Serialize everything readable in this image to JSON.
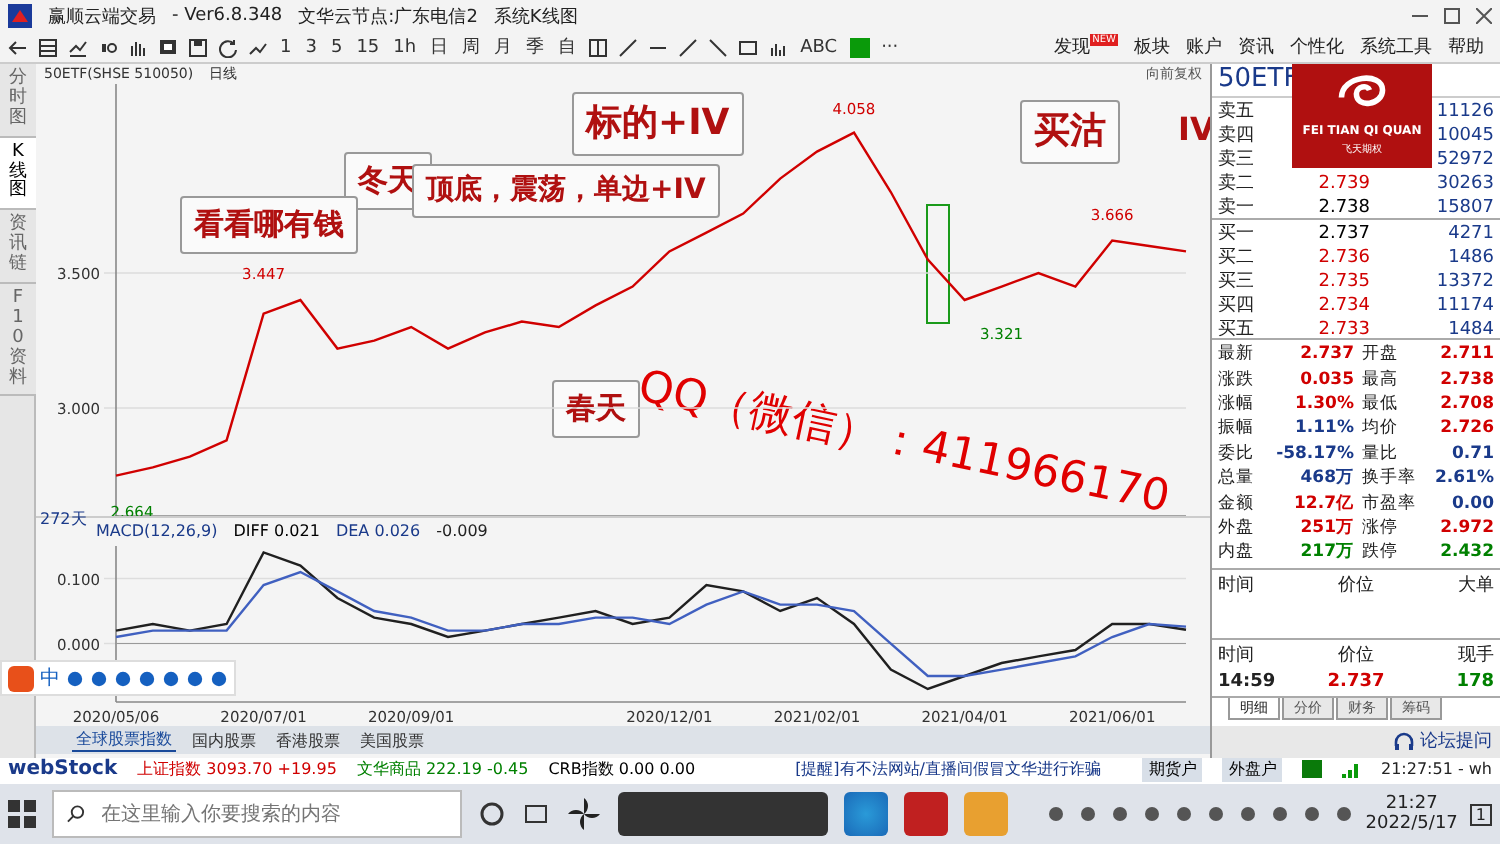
{
  "window": {
    "title": "赢顺云端交易",
    "version": "- Ver6.8.348",
    "node": "文华云节点:广东电信2",
    "view": "系统K线图"
  },
  "toolbar": {
    "periods": [
      "1",
      "3",
      "5",
      "15",
      "1h",
      "日",
      "周",
      "月",
      "季",
      "自"
    ],
    "text_tools": [
      "ABC",
      "···"
    ]
  },
  "menu": [
    {
      "label": "发现",
      "badge": "NEW"
    },
    {
      "label": "板块"
    },
    {
      "label": "账户"
    },
    {
      "label": "资讯"
    },
    {
      "label": "个性化"
    },
    {
      "label": "系统工具"
    },
    {
      "label": "帮助"
    }
  ],
  "side_tabs": [
    {
      "label": "分时图",
      "selected": false
    },
    {
      "label": "K线图",
      "selected": true
    },
    {
      "label": "资讯链",
      "selected": false
    },
    {
      "label": "F10资料",
      "selected": false
    }
  ],
  "chart": {
    "symbol": "50ETF(SHSE 510050)",
    "period": "日线",
    "adjust": "向前复权",
    "span_label": "272天",
    "chart_data": {
      "type": "line",
      "ylim": [
        2.6,
        4.2
      ],
      "yticks": [
        {
          "value": 3.0,
          "label": "3.000"
        },
        {
          "value": 3.5,
          "label": "3.500"
        }
      ],
      "series": [
        {
          "color": "#d00000",
          "values": [
            2.75,
            2.78,
            2.82,
            2.88,
            3.35,
            3.4,
            3.22,
            3.25,
            3.3,
            3.22,
            3.28,
            3.32,
            3.3,
            3.38,
            3.45,
            3.58,
            3.65,
            3.72,
            3.85,
            3.95,
            4.02,
            3.8,
            3.55,
            3.4,
            3.45,
            3.5,
            3.45,
            3.62,
            3.6,
            3.58
          ]
        }
      ],
      "annotations": [
        "2.664",
        "3.447",
        "4.058",
        "3.321",
        "3.666"
      ]
    }
  },
  "notes": [
    {
      "text": "标的+IV",
      "kind": "boxed"
    },
    {
      "text": "买沽",
      "kind": "boxed"
    },
    {
      "text": "IV",
      "kind": "plain"
    },
    {
      "text": "冬天",
      "kind": "boxed"
    },
    {
      "text": "看看哪有钱",
      "kind": "boxed"
    },
    {
      "text": "顶底，震荡，单边+IV",
      "kind": "boxed"
    },
    {
      "text": "QQ（微信）：411966170",
      "kind": "stamp"
    },
    {
      "text": "春天",
      "kind": "boxed"
    }
  ],
  "ime": {
    "label": "中"
  },
  "macd": {
    "label": "MACD(12,26,9)",
    "legend_values": [
      "0.021",
      "0.026"
    ],
    "value": "-0.009",
    "chart_data": {
      "type": "line",
      "ylim": [
        -0.09,
        0.15
      ],
      "yticks": [
        {
          "value": 0,
          "label": "0.000"
        },
        {
          "value": 0.1,
          "label": "0.100"
        }
      ],
      "categories": [
        "2020/05/06",
        null,
        null,
        null,
        "2020/07/01",
        null,
        null,
        null,
        "2020/09/01",
        null,
        null,
        null,
        null,
        null,
        null,
        "2020/12/01",
        null,
        null,
        null,
        "2021/02/01",
        null,
        null,
        null,
        "2021/04/01",
        null,
        null,
        null,
        "2021/06/01",
        null,
        null
      ],
      "series": [
        {
          "name": "DIFF",
          "color": "#202020",
          "values": [
            0.02,
            0.03,
            0.02,
            0.03,
            0.14,
            0.12,
            0.07,
            0.04,
            0.03,
            0.01,
            0.02,
            0.03,
            0.04,
            0.05,
            0.03,
            0.04,
            0.09,
            0.08,
            0.05,
            0.07,
            0.03,
            -0.04,
            -0.07,
            -0.05,
            -0.03,
            -0.02,
            -0.01,
            0.03,
            0.03,
            0.021
          ]
        },
        {
          "name": "DEA",
          "color": "#4060c0",
          "values": [
            0.01,
            0.02,
            0.02,
            0.02,
            0.09,
            0.11,
            0.08,
            0.05,
            0.04,
            0.02,
            0.02,
            0.03,
            0.03,
            0.04,
            0.04,
            0.03,
            0.06,
            0.08,
            0.06,
            0.06,
            0.05,
            0.0,
            -0.05,
            -0.05,
            -0.04,
            -0.03,
            -0.02,
            0.01,
            0.03,
            0.026
          ]
        }
      ]
    }
  },
  "bottom_tabs": [
    {
      "label": "全球股票指数",
      "selected": true
    },
    {
      "label": "国内股票",
      "selected": false
    },
    {
      "label": "香港股票",
      "selected": false
    },
    {
      "label": "美国股票",
      "selected": false
    }
  ],
  "quote": {
    "symbol": "50ETF",
    "logo": {
      "brand": "FEI TIAN QI QUAN",
      "brand_cn": "飞天期权"
    },
    "order_book": [
      {
        "label": "卖五",
        "volume": "11126"
      },
      {
        "label": "卖四",
        "volume": "10045"
      },
      {
        "label": "卖三",
        "volume": "52972"
      },
      {
        "label": "卖二",
        "price": "2.739",
        "color": "#d00000",
        "volume": "30263"
      },
      {
        "label": "卖一",
        "price": "2.738",
        "color": "#000000",
        "volume": "15807"
      },
      {
        "label": "买一",
        "price": "2.737",
        "color": "#000000",
        "volume": "4271"
      },
      {
        "label": "买二",
        "price": "2.736",
        "color": "#d00000",
        "volume": "1486"
      },
      {
        "label": "买三",
        "price": "2.735",
        "color": "#d00000",
        "volume": "13372"
      },
      {
        "label": "买四",
        "price": "2.734",
        "color": "#d00000",
        "volume": "11174"
      },
      {
        "label": "买五",
        "price": "2.733",
        "color": "#d00000",
        "volume": "1484"
      }
    ],
    "stats": [
      {
        "label": "最新",
        "value": "2.737",
        "color": "#d00000"
      },
      {
        "label": "开盘",
        "value": "2.711",
        "color": "#d00000"
      },
      {
        "label": "涨跌",
        "value": "0.035",
        "color": "#d00000"
      },
      {
        "label": "最高",
        "value": "2.738",
        "color": "#d00000"
      },
      {
        "label": "涨幅",
        "value": "1.30%",
        "color": "#d00000"
      },
      {
        "label": "最低",
        "value": "2.708",
        "color": "#d00000"
      },
      {
        "label": "振幅",
        "value": "1.11%",
        "color": "#1a3a8a"
      },
      {
        "label": "均价",
        "value": "2.726",
        "color": "#d00000"
      },
      {
        "label": "委比",
        "value": "-58.17%",
        "color": "#1a3a8a"
      },
      {
        "label": "量比",
        "value": "0.71",
        "color": "#1a3a8a"
      },
      {
        "label": "总量",
        "value": "468万",
        "color": "#1a3a8a"
      },
      {
        "label": "换手率",
        "value": "2.61%",
        "color": "#1a3a8a"
      },
      {
        "label": "金额",
        "value": "12.7亿",
        "color": "#d00000"
      },
      {
        "label": "市盈率",
        "value": "0.00",
        "color": "#1a3a8a"
      },
      {
        "label": "外盘",
        "value": "251万",
        "color": "#d00000"
      },
      {
        "label": "涨停",
        "value": "2.972",
        "color": "#d00000"
      },
      {
        "label": "内盘",
        "value": "217万",
        "color": "#008000"
      },
      {
        "label": "跌停",
        "value": "2.432",
        "color": "#008000"
      }
    ],
    "big_orders": {
      "columns": [
        "时间",
        "价位",
        "大单"
      ]
    },
    "ticks": {
      "columns": [
        "时间",
        "价位",
        "现手"
      ],
      "rows": [
        {
          "time": "14:59",
          "price": "2.737",
          "volume": "178"
        }
      ]
    },
    "tabs": [
      {
        "label": "明细",
        "selected": true
      },
      {
        "label": "分价",
        "selected": false
      },
      {
        "label": "财务",
        "selected": false
      },
      {
        "label": "筹码",
        "selected": false
      }
    ],
    "forum_link": "论坛提问"
  },
  "status_bar": {
    "logo": "webStock",
    "indices": [
      {
        "name": "上证指数",
        "value": "3093.70",
        "change": "+19.95",
        "color": "#d00000"
      },
      {
        "name": "文华商品",
        "value": "222.19",
        "change": "-0.45",
        "color": "#008000"
      },
      {
        "name": "CRB指数",
        "value": "0.00",
        "change": "0.00",
        "color": "#000000"
      }
    ],
    "notice": "[提醒]有不法网站/直播间假冒文华进行诈骗",
    "buttons": [
      "期货户",
      "外盘户"
    ],
    "clock": "21:27:51 - wh"
  },
  "taskbar": {
    "search_placeholder": "在这里输入你要搜索的内容",
    "time": "21:27",
    "date": "2022/5/17",
    "notifications": "1"
  }
}
